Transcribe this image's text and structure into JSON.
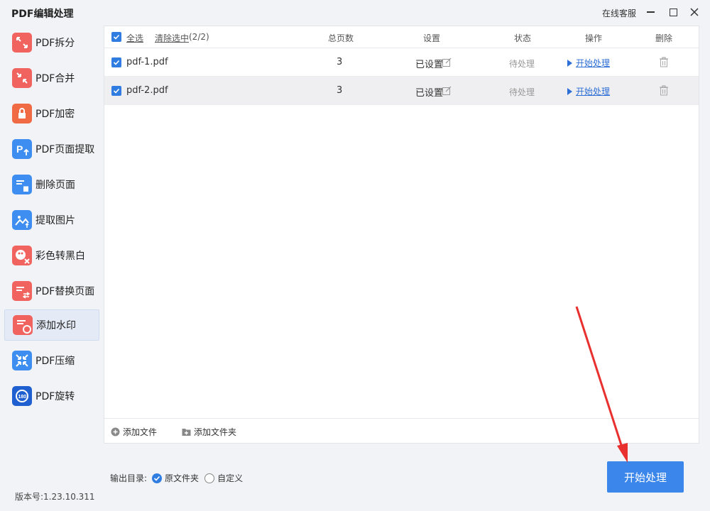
{
  "app": {
    "title": "PDF编辑处理",
    "service": "在线客服"
  },
  "sidebar": {
    "items": [
      {
        "label": "PDF拆分",
        "icon": "split-icon",
        "color": "#f0635f"
      },
      {
        "label": "PDF合并",
        "icon": "merge-icon",
        "color": "#f0635f"
      },
      {
        "label": "PDF加密",
        "icon": "lock-icon",
        "color": "#f06a44"
      },
      {
        "label": "PDF页面提取",
        "icon": "page-extract-icon",
        "color": "#3d8ef0"
      },
      {
        "label": "删除页面",
        "icon": "delete-page-icon",
        "color": "#3d8ef0"
      },
      {
        "label": "提取图片",
        "icon": "extract-image-icon",
        "color": "#3d8ef0"
      },
      {
        "label": "彩色转黑白",
        "icon": "color-to-bw-icon",
        "color": "#f0635f"
      },
      {
        "label": "PDF替换页面",
        "icon": "replace-page-icon",
        "color": "#f0635f"
      },
      {
        "label": "添加水印",
        "icon": "watermark-icon",
        "color": "#f0635f",
        "active": true
      },
      {
        "label": "PDF压缩",
        "icon": "compress-icon",
        "color": "#3d8ef0"
      },
      {
        "label": "PDF旋转",
        "icon": "rotate-icon",
        "color": "#1f5fcf"
      }
    ]
  },
  "table": {
    "select_all": "全选",
    "clear_selection": "清除选中",
    "selection_count": "(2/2)",
    "columns": {
      "pages": "总页数",
      "settings": "设置",
      "status": "状态",
      "action": "操作",
      "delete": "删除"
    },
    "rows": [
      {
        "name": "pdf-1.pdf",
        "pages": "3",
        "settings": "已设置",
        "status": "待处理",
        "action": "开始处理"
      },
      {
        "name": "pdf-2.pdf",
        "pages": "3",
        "settings": "已设置",
        "status": "待处理",
        "action": "开始处理"
      }
    ]
  },
  "footer": {
    "add_file": "添加文件",
    "add_folder": "添加文件夹"
  },
  "output": {
    "label": "输出目录:",
    "option_original": "原文件夹",
    "option_custom": "自定义",
    "selected": "原文件夹"
  },
  "version": "版本号:1.23.10.311",
  "start_button": "开始处理",
  "colors": {
    "accent": "#3a86ea",
    "annotation_arrow": "#e8302e"
  }
}
